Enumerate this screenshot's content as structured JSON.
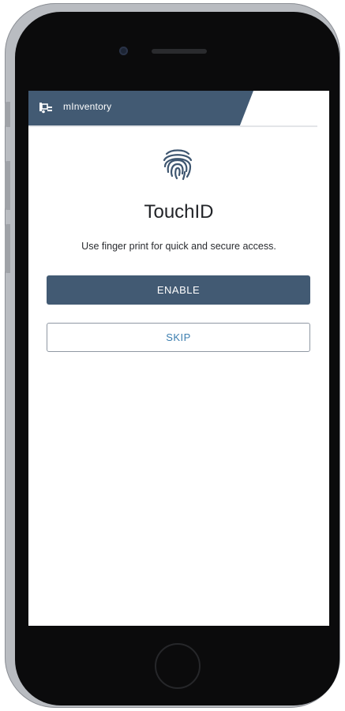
{
  "app": {
    "title": "mInventory",
    "icon": "forklift-icon"
  },
  "screen": {
    "icon": "fingerprint-icon",
    "title": "TouchID",
    "subtitle": "Use finger print for quick and secure access."
  },
  "buttons": {
    "enable_label": "ENABLE",
    "skip_label": "SKIP"
  },
  "colors": {
    "primary": "#425a73",
    "skip_text": "#3d7fb0",
    "skip_border": "#8f98a3"
  }
}
